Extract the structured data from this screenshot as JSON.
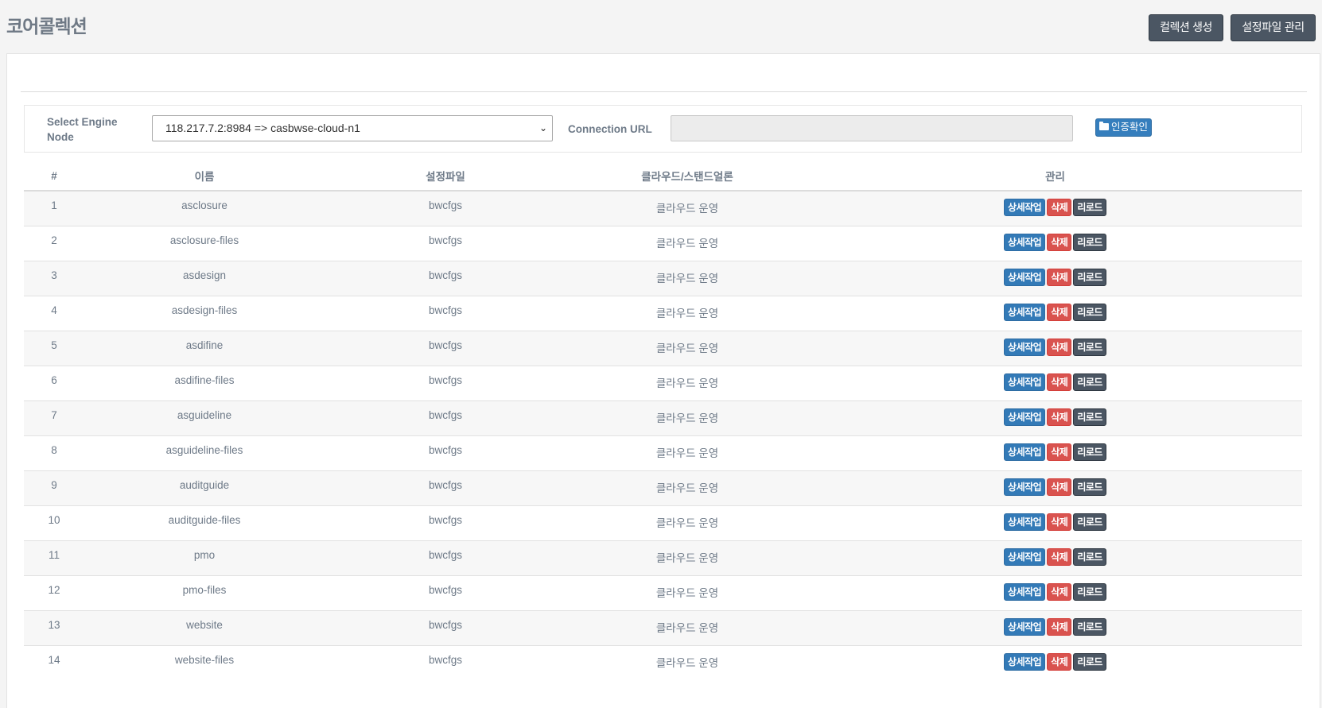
{
  "header": {
    "title": "코어콜렉션",
    "create_label": "컬렉션 생성",
    "config_label": "설정파일 관리"
  },
  "engine": {
    "select_label": "Select Engine Node",
    "selected_node": "118.217.7.2:8984 => casbwse-cloud-n1",
    "connection_label": "Connection URL",
    "connection_value": "",
    "auth_label": "인증확인"
  },
  "table": {
    "headers": [
      "#",
      "이름",
      "설정파일",
      "클라우드/스탠드얼론",
      "관리"
    ],
    "action_labels": {
      "detail": "상세작업",
      "delete": "삭제",
      "reload": "리로드"
    },
    "rows": [
      {
        "num": "1",
        "name": "asclosure",
        "config": "bwcfgs",
        "mode": "클라우드 운영"
      },
      {
        "num": "2",
        "name": "asclosure-files",
        "config": "bwcfgs",
        "mode": "클라우드 운영"
      },
      {
        "num": "3",
        "name": "asdesign",
        "config": "bwcfgs",
        "mode": "클라우드 운영"
      },
      {
        "num": "4",
        "name": "asdesign-files",
        "config": "bwcfgs",
        "mode": "클라우드 운영"
      },
      {
        "num": "5",
        "name": "asdifine",
        "config": "bwcfgs",
        "mode": "클라우드 운영"
      },
      {
        "num": "6",
        "name": "asdifine-files",
        "config": "bwcfgs",
        "mode": "클라우드 운영"
      },
      {
        "num": "7",
        "name": "asguideline",
        "config": "bwcfgs",
        "mode": "클라우드 운영"
      },
      {
        "num": "8",
        "name": "asguideline-files",
        "config": "bwcfgs",
        "mode": "클라우드 운영"
      },
      {
        "num": "9",
        "name": "auditguide",
        "config": "bwcfgs",
        "mode": "클라우드 운영"
      },
      {
        "num": "10",
        "name": "auditguide-files",
        "config": "bwcfgs",
        "mode": "클라우드 운영"
      },
      {
        "num": "11",
        "name": "pmo",
        "config": "bwcfgs",
        "mode": "클라우드 운영"
      },
      {
        "num": "12",
        "name": "pmo-files",
        "config": "bwcfgs",
        "mode": "클라우드 운영"
      },
      {
        "num": "13",
        "name": "website",
        "config": "bwcfgs",
        "mode": "클라우드 운영"
      },
      {
        "num": "14",
        "name": "website-files",
        "config": "bwcfgs",
        "mode": "클라우드 운영"
      }
    ]
  },
  "colors": {
    "primary": "#337ab7",
    "danger": "#d9534f",
    "dark": "#4b5663"
  }
}
